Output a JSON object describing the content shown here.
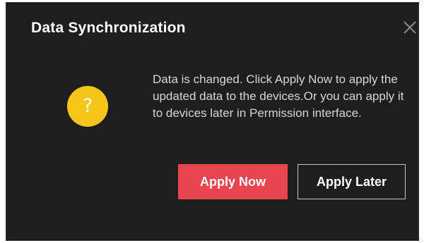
{
  "dialog": {
    "title": "Data Synchronization",
    "close_icon": "close-icon",
    "icon": {
      "name": "question-icon",
      "glyph": "?",
      "color": "#f5c518"
    },
    "message": "Data is changed. Click Apply Now to apply the updated data to the devices.Or you can apply it to devices later in Permission interface.",
    "buttons": {
      "apply_now": "Apply Now",
      "apply_later": "Apply Later"
    }
  },
  "colors": {
    "dialog_background": "#1e1e1e",
    "primary_button": "#e8454f",
    "text": "#ffffff",
    "message_text": "#d6d6d6"
  }
}
